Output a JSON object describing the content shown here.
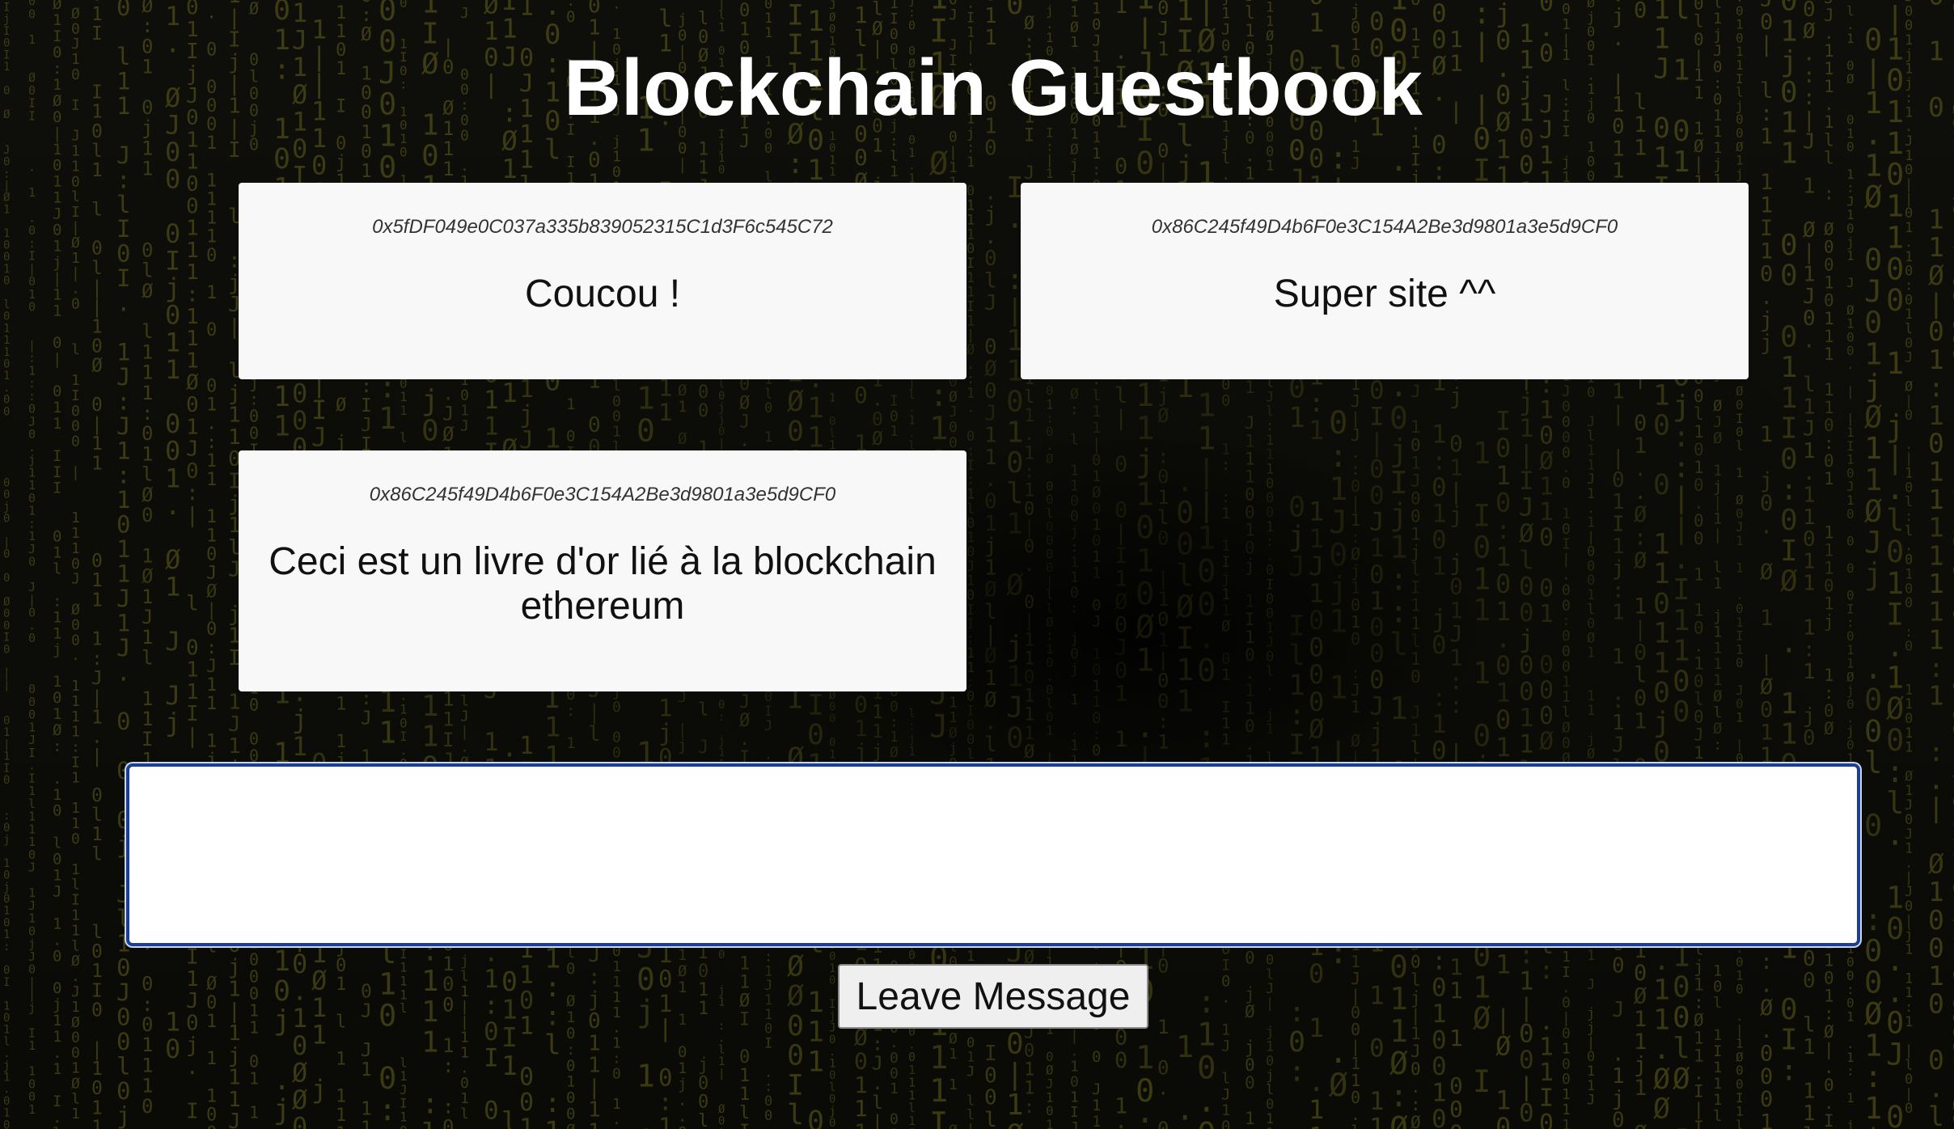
{
  "page": {
    "title": "Blockchain Guestbook"
  },
  "messages": [
    {
      "address": "0x5fDF049e0C037a335b839052315C1d3F6c545C72",
      "text": "Coucou !"
    },
    {
      "address": "0x86C245f49D4b6F0e3C154A2Be3d9801a3e5d9CF0",
      "text": "Super site ^^"
    },
    {
      "address": "0x86C245f49D4b6F0e3C154A2Be3d9801a3e5d9CF0",
      "text": "Ceci est un livre d'or lié à la blockchain ethereum"
    }
  ],
  "composer": {
    "value": "",
    "button_label": "Leave Message"
  },
  "theme": {
    "background": "#0b0b08",
    "matrix_glyph_color": "#6b6a1c",
    "card_background": "#f8f8f8",
    "input_focus_border": "#1e3f8f"
  }
}
